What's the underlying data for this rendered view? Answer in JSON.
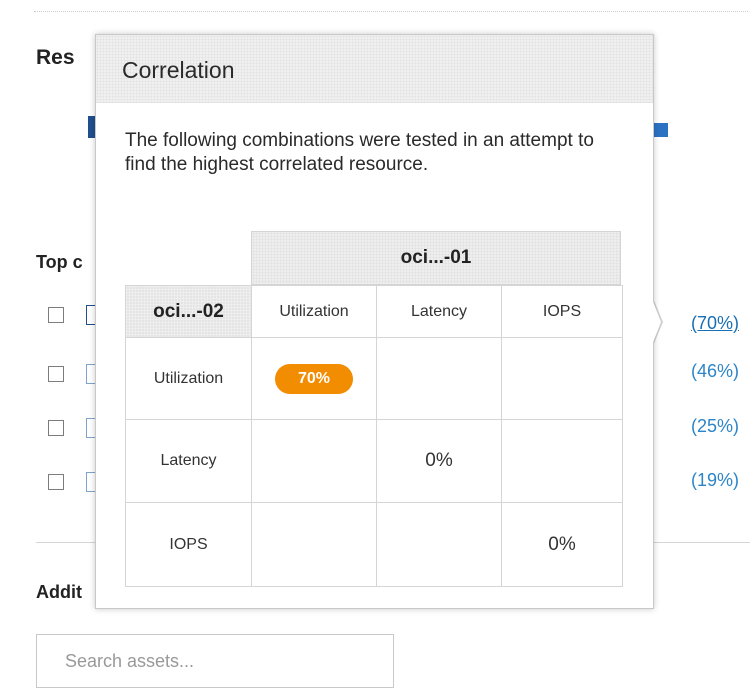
{
  "background": {
    "title_fragment": "Res",
    "top_heading_fragment": "Top c",
    "additional_fragment": "Addit",
    "search_placeholder": "Search assets...",
    "rows": [
      {
        "pct": "(70%)"
      },
      {
        "pct": "(46%)"
      },
      {
        "pct": "(25%)"
      },
      {
        "pct": "(19%)"
      }
    ]
  },
  "popover": {
    "title": "Correlation",
    "description": "The following combinations were tested in an attempt to find the highest correlated resource.",
    "table": {
      "group_header": "oci...-01",
      "corner_header": "oci...-02",
      "columns": [
        "Utilization",
        "Latency",
        "IOPS"
      ],
      "rows": [
        {
          "label": "Utilization",
          "cells": [
            "70%",
            "",
            ""
          ]
        },
        {
          "label": "Latency",
          "cells": [
            "",
            "0%",
            ""
          ]
        },
        {
          "label": "IOPS",
          "cells": [
            "",
            "",
            "0%"
          ]
        }
      ],
      "highlight_color": "#f28c00"
    }
  },
  "colors": {
    "link": "#2b85c8",
    "accent_bar": "#2c72c3"
  }
}
